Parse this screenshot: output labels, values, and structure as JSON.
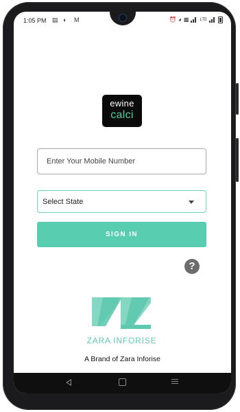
{
  "status_bar": {
    "time": "1:05 PM",
    "network_label": "LTE"
  },
  "app": {
    "logo_top": "ewine",
    "logo_bottom": "calci"
  },
  "login": {
    "mobile_placeholder": "Enter Your Mobile Number",
    "state_selected": "Select State",
    "sign_in_label": "SIGN IN"
  },
  "help": {
    "label": "?"
  },
  "brand": {
    "name": "ZARA INFORISE",
    "tagline": "A Brand of Zara Inforise"
  },
  "colors": {
    "accent": "#58cdb0",
    "logo_accent": "#4fd1a8",
    "help_icon": "#6c6c6c"
  }
}
